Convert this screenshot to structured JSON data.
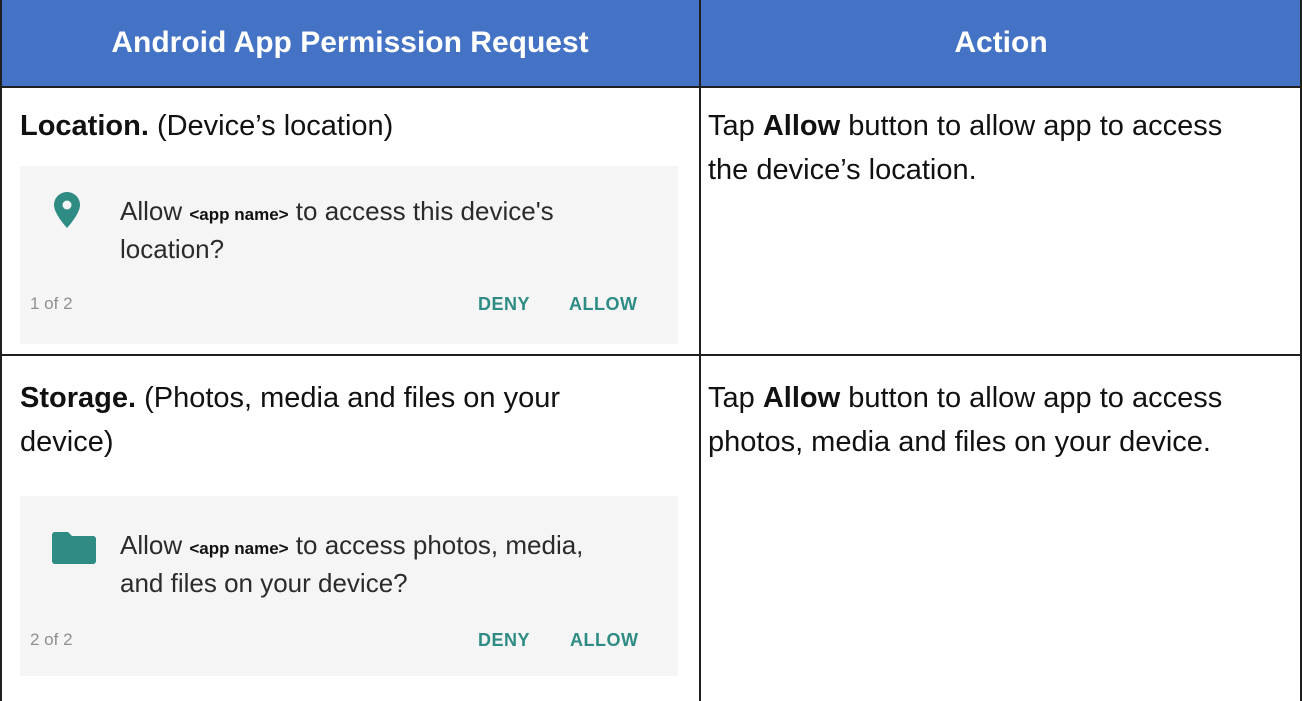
{
  "header": {
    "col1": "Android App Permission Request",
    "col2": "Action"
  },
  "rows": [
    {
      "title": "Location.",
      "subtitle": " (Device’s location)",
      "dialog": {
        "icon": "location-pin-icon",
        "prefix": "Allow ",
        "app_name": "<app name>",
        "message_line1_suffix": " to access this device's",
        "message_line2": "location?",
        "counter": "1 of 2",
        "deny_label": "DENY",
        "allow_label": "ALLOW"
      },
      "action_prefix": "Tap ",
      "action_bold": "Allow",
      "action_line1_suffix": " button to allow app to access",
      "action_line2": "the device’s location."
    },
    {
      "title": "Storage.",
      "subtitle": " (Photos, media and files on your",
      "subtitle_line2": "device)",
      "dialog": {
        "icon": "folder-icon",
        "prefix": "Allow ",
        "app_name": "<app name>",
        "message_line1_suffix": " to access photos, media,",
        "message_line2": "and files on your device?",
        "counter": "2 of 2",
        "deny_label": "DENY",
        "allow_label": "ALLOW"
      },
      "action_prefix": "Tap ",
      "action_bold": "Allow",
      "action_line1_suffix": " button to allow app to access",
      "action_line2": "photos, media and files on your device."
    }
  ],
  "colors": {
    "header_bg": "#4472c4",
    "accent": "#2e8c84",
    "dialog_bg": "#f5f5f5"
  }
}
